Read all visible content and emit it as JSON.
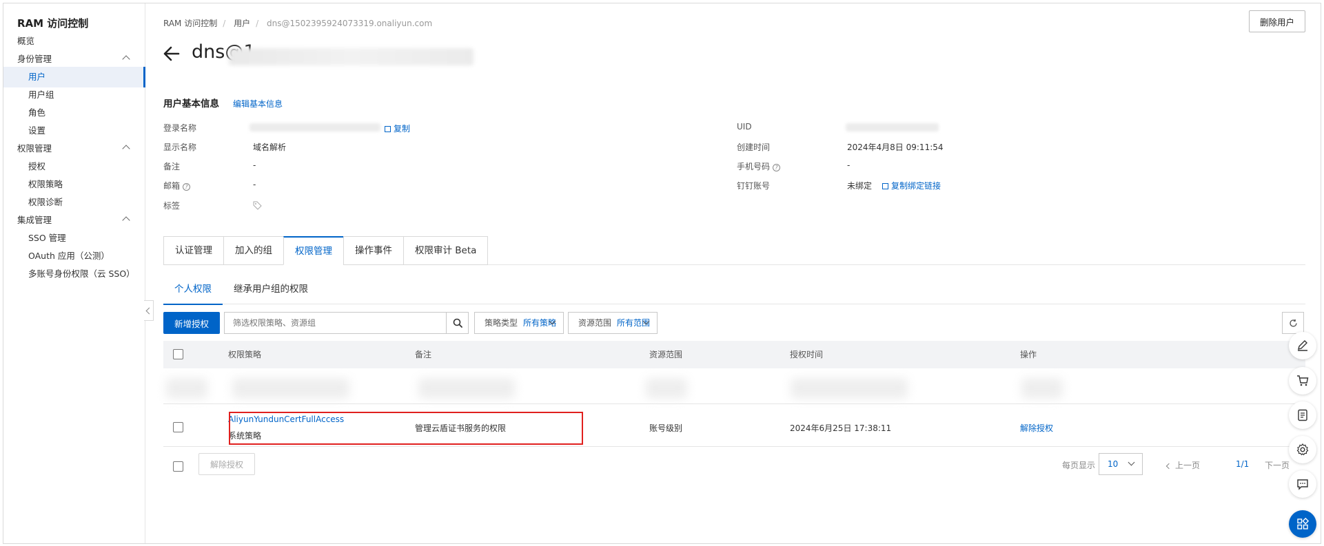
{
  "sidebar": {
    "title": "RAM 访问控制",
    "items": [
      {
        "label": "概览"
      },
      {
        "label": "身份管理"
      },
      {
        "label": "用户"
      },
      {
        "label": "用户组"
      },
      {
        "label": "角色"
      },
      {
        "label": "设置"
      },
      {
        "label": "权限管理"
      },
      {
        "label": "授权"
      },
      {
        "label": "权限策略"
      },
      {
        "label": "权限诊断"
      },
      {
        "label": "集成管理"
      },
      {
        "label": "SSO 管理"
      },
      {
        "label": "OAuth 应用（公测）"
      },
      {
        "label": "多账号身份权限（云 SSO）"
      }
    ]
  },
  "breadcrumb": [
    "RAM 访问控制",
    "用户",
    "dns@1502395924073319.onaliyun.com"
  ],
  "header": {
    "delete_label": "删除用户",
    "title": "dns@1"
  },
  "basic_info": {
    "title": "用户基本信息",
    "edit_label": "编辑基本信息",
    "login_name_label": "登录名称",
    "copy_label": "复制",
    "display_name_label": "显示名称",
    "display_name": "域名解析",
    "note_label": "备注",
    "note": "-",
    "email_label": "邮箱",
    "email": "-",
    "tags_label": "标签",
    "uid_label": "UID",
    "created_label": "创建时间",
    "created": "2024年4月8日 09:11:54",
    "phone_label": "手机号码",
    "phone": "-",
    "dingtalk_label": "钉钉账号",
    "dingtalk": "未绑定",
    "copy_bind_label": "复制绑定链接"
  },
  "tabs": [
    "认证管理",
    "加入的组",
    "权限管理",
    "操作事件",
    "权限审计 Beta"
  ],
  "subtabs": [
    "个人权限",
    "继承用户组的权限"
  ],
  "toolbar": {
    "add_label": "新增授权",
    "search_placeholder": "筛选权限策略、资源组",
    "policy_type_label": "策略类型",
    "policy_type_value": "所有策略",
    "scope_label": "资源范围",
    "scope_value": "所有范围"
  },
  "table": {
    "headers": [
      "权限策略",
      "备注",
      "资源范围",
      "授权时间",
      "操作"
    ],
    "row": {
      "policy": "AliyunYundunCertFullAccess",
      "policy_type": "系统策略",
      "note": "管理云盾证书服务的权限",
      "scope": "账号级别",
      "time": "2024年6月25日 17:38:11",
      "action": "解除授权"
    }
  },
  "footer": {
    "revoke_label": "解除授权",
    "per_page_label": "每页显示",
    "per_page": "10",
    "prev": "上一页",
    "page": "1/1",
    "next": "下一页"
  },
  "colors": {
    "primary": "#0064c8",
    "highlight": "#e0201e"
  }
}
